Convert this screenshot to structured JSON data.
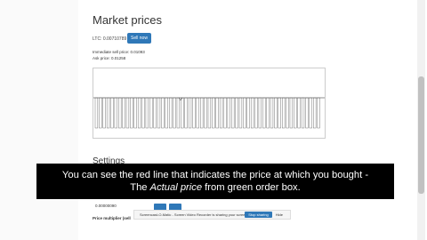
{
  "page": {
    "title": "Market prices",
    "ltc_label": "LTC: 0.00710789",
    "sell_now_label": "Sell now",
    "sell_price_line": "Immediate sell price: 0.01093",
    "ask_price_line": "Ask price: 0.01258"
  },
  "settings": {
    "title": "Settings",
    "input_value": "0.00000090",
    "price_multiplier_label": "Price multiplier (sell"
  },
  "caption": {
    "line1": "You can see the red line that indicates the price at which you bought -",
    "line2_prefix": "The ",
    "line2_italic": "Actual price",
    "line2_suffix": " from green order box."
  },
  "share_bar": {
    "text": "Screencast-O-Matic - Screen Video Recorder is sharing your screen.",
    "stop_label": "Stop sharing",
    "hide_label": "Hide"
  },
  "chart_data": {
    "type": "bar",
    "title": "",
    "xlabel": "",
    "ylabel": "",
    "bar_count": 58,
    "bar_color": "#ffffff",
    "bar_border_color": "#555555",
    "reference_line_color": "#666666"
  }
}
